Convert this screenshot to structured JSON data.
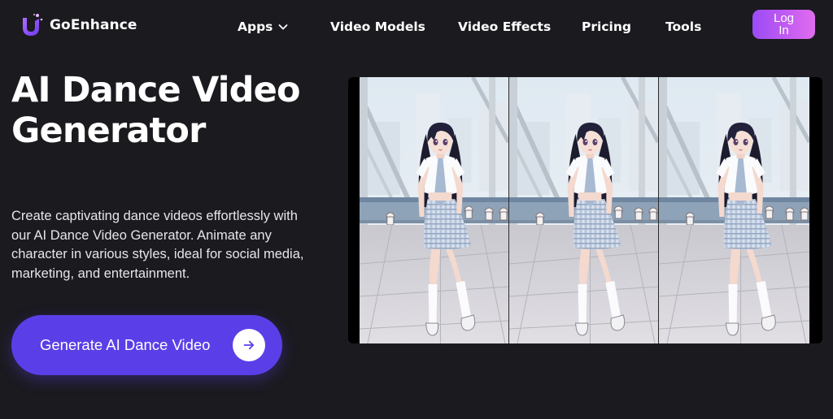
{
  "brand": {
    "name": "GoEnhance",
    "logo_letter": "U",
    "accent_color": "#5a3fe8",
    "gradient_colors": [
      "#9a4cf5",
      "#e06df0"
    ]
  },
  "nav": {
    "items": [
      {
        "label": "Apps",
        "has_dropdown": true,
        "icon": "chevron-down-icon"
      },
      {
        "label": "Video Models",
        "has_dropdown": false
      },
      {
        "label": "Video Effects",
        "has_dropdown": false
      },
      {
        "label": "Pricing",
        "has_dropdown": false
      },
      {
        "label": "Tools",
        "has_dropdown": false
      }
    ],
    "login_label": "Log In"
  },
  "hero": {
    "title": "AI Dance Video Generator",
    "description": "Create captivating dance videos effortlessly with our AI Dance Video Generator. Animate any character in various styles, ideal for social media, marketing, and entertainment.",
    "cta_label": "Generate AI Dance Video",
    "cta_icon": "arrow-right-icon"
  },
  "preview": {
    "frame_count": 3,
    "subject": "anime-girl-dancing"
  }
}
